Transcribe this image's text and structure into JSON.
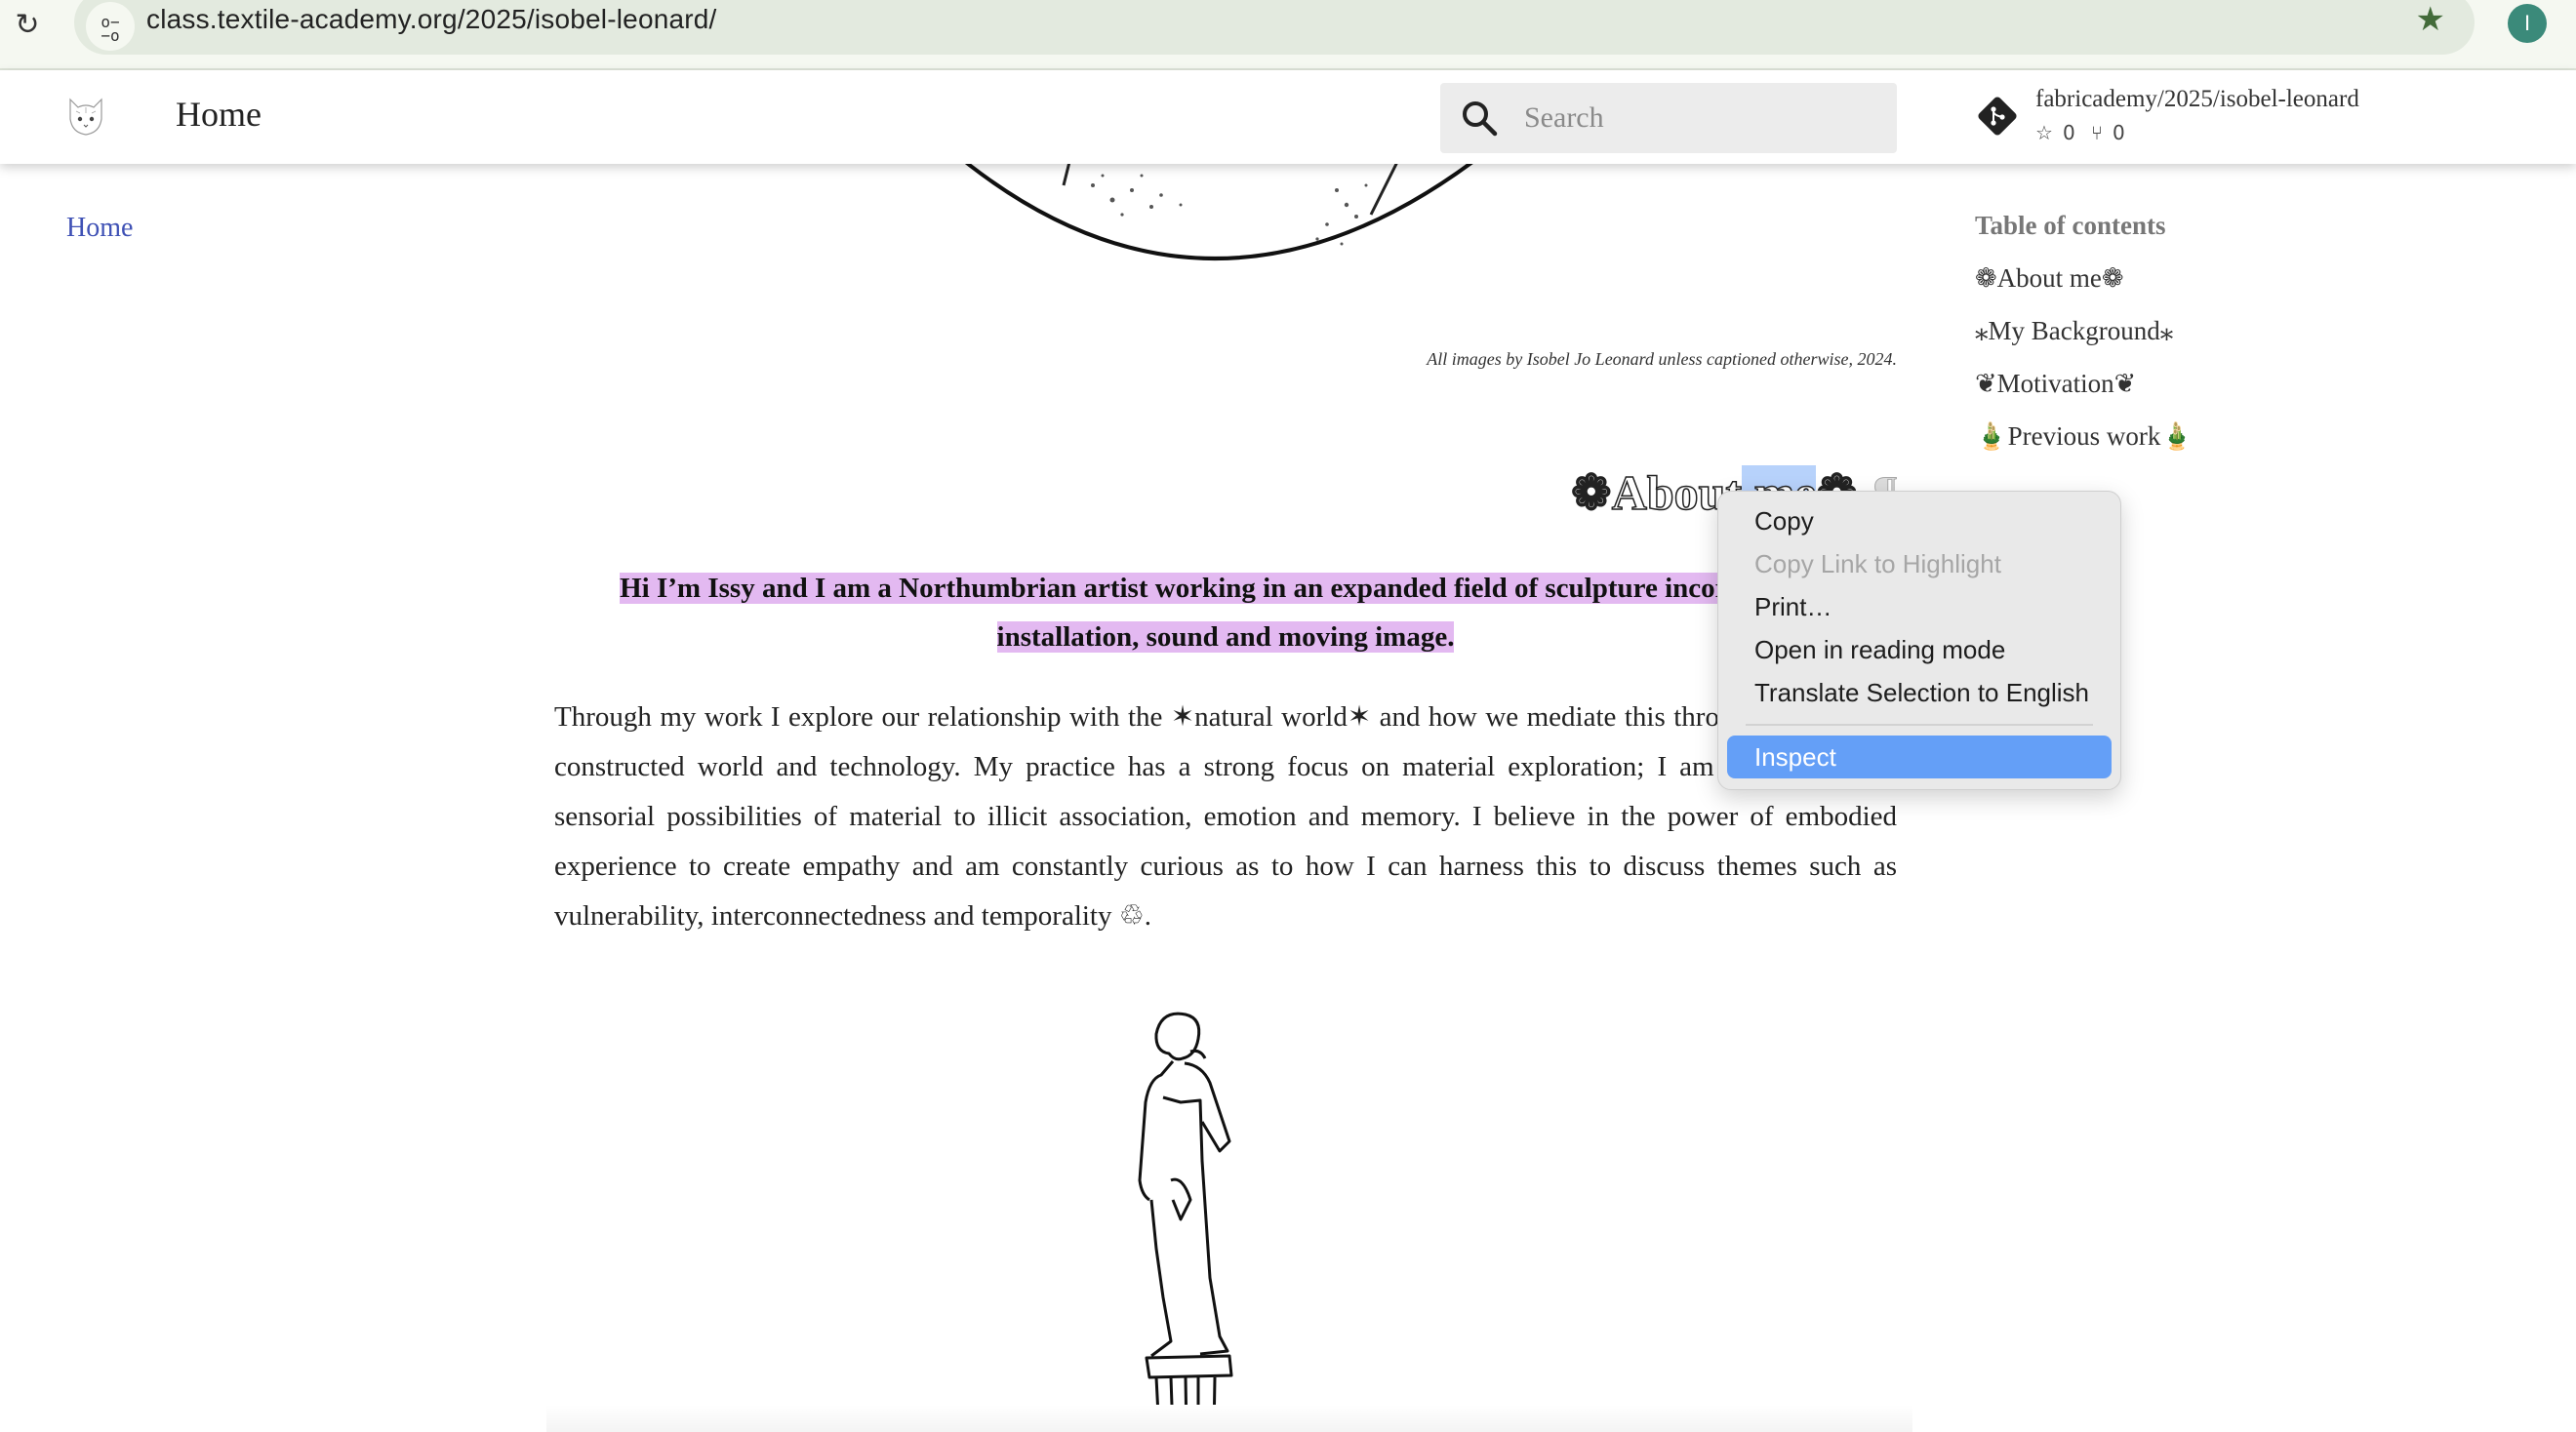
{
  "browser": {
    "url": "class.textile-academy.org/2025/isobel-leonard/",
    "reload_icon": "reload-icon",
    "site_info_icon": "tune-icon",
    "bookmark_icon": "star-filled-icon",
    "profile_initial": "I",
    "colors": {
      "bookmark": "#436b3a",
      "profile": "#3b8a7a"
    }
  },
  "header": {
    "title": "Home",
    "logo_icon": "cat-face-logo",
    "search": {
      "placeholder": "Search",
      "value": ""
    },
    "repo": {
      "name": "fabricademy/2025/isobel-leonard",
      "stars": "0",
      "forks": "0"
    }
  },
  "nav": {
    "home_link": "Home",
    "link_color": "#3f51b5"
  },
  "toc": {
    "title": "Table of contents",
    "items": [
      {
        "label": "❁About me❁"
      },
      {
        "label": "⁎My Background⁎"
      },
      {
        "label": "❦Motivation❦"
      },
      {
        "label": "🎍Previous work🎍"
      }
    ]
  },
  "content": {
    "caption": "All images by Isobel Jo Leonard unless captioned otherwise, 2024.",
    "heading": {
      "orn_left": "❁",
      "text_a": "About",
      "text_b": " me",
      "orn_right": "❁",
      "anchor": "¶"
    },
    "lead_line1": "Hi I’m Issy and I am a Northumbrian artist working in an expanded field of sculpture incorporating",
    "lead_line2": "installation, sound and moving image.",
    "highlight_color": "#e3b9f1",
    "body": "Through my work I explore our relationship with the ✶natural world✶ and how we mediate this through our bodies, constructed world and technology. My practice has a strong focus on material exploration; I am excited by the sensorial possibilities of material to illicit association, emotion and memory. I believe in the power of embodied experience to create empathy and am constantly curious as to how I can harness this to discuss themes such as vulnerability, interconnectedness and temporality ♲."
  },
  "context_menu": {
    "items": [
      {
        "label": "Copy",
        "state": "enabled"
      },
      {
        "label": "Copy Link to Highlight",
        "state": "disabled"
      },
      {
        "label": "Print…",
        "state": "enabled"
      },
      {
        "label": "Open in reading mode",
        "state": "enabled"
      },
      {
        "label": "Translate Selection to English",
        "state": "enabled"
      }
    ],
    "inspect": {
      "label": "Inspect",
      "state": "highlighted"
    },
    "highlight_color": "#649ff7"
  }
}
